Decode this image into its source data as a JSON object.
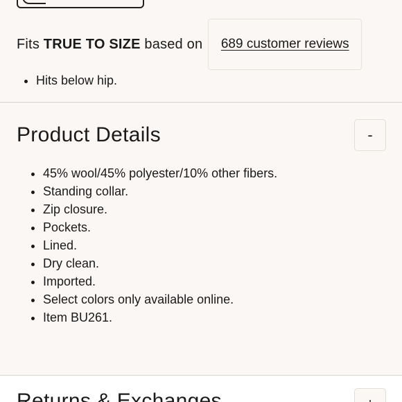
{
  "fit": {
    "prefix": "Fits ",
    "emphasis": "TRUE TO SIZE",
    "suffix": " based on",
    "reviews_link": "689 customer reviews",
    "notes": [
      "Hits below hip."
    ]
  },
  "product_details": {
    "title": "Product Details",
    "toggle": "-",
    "items": [
      "45% wool/45% polyester/10% other fibers.",
      "Standing collar.",
      "Zip closure.",
      "Pockets.",
      "Lined.",
      "Dry clean.",
      "Imported.",
      "Select colors only available online.",
      "Item BU261."
    ]
  },
  "returns": {
    "title": "Returns & Exchanges",
    "toggle": "+"
  }
}
